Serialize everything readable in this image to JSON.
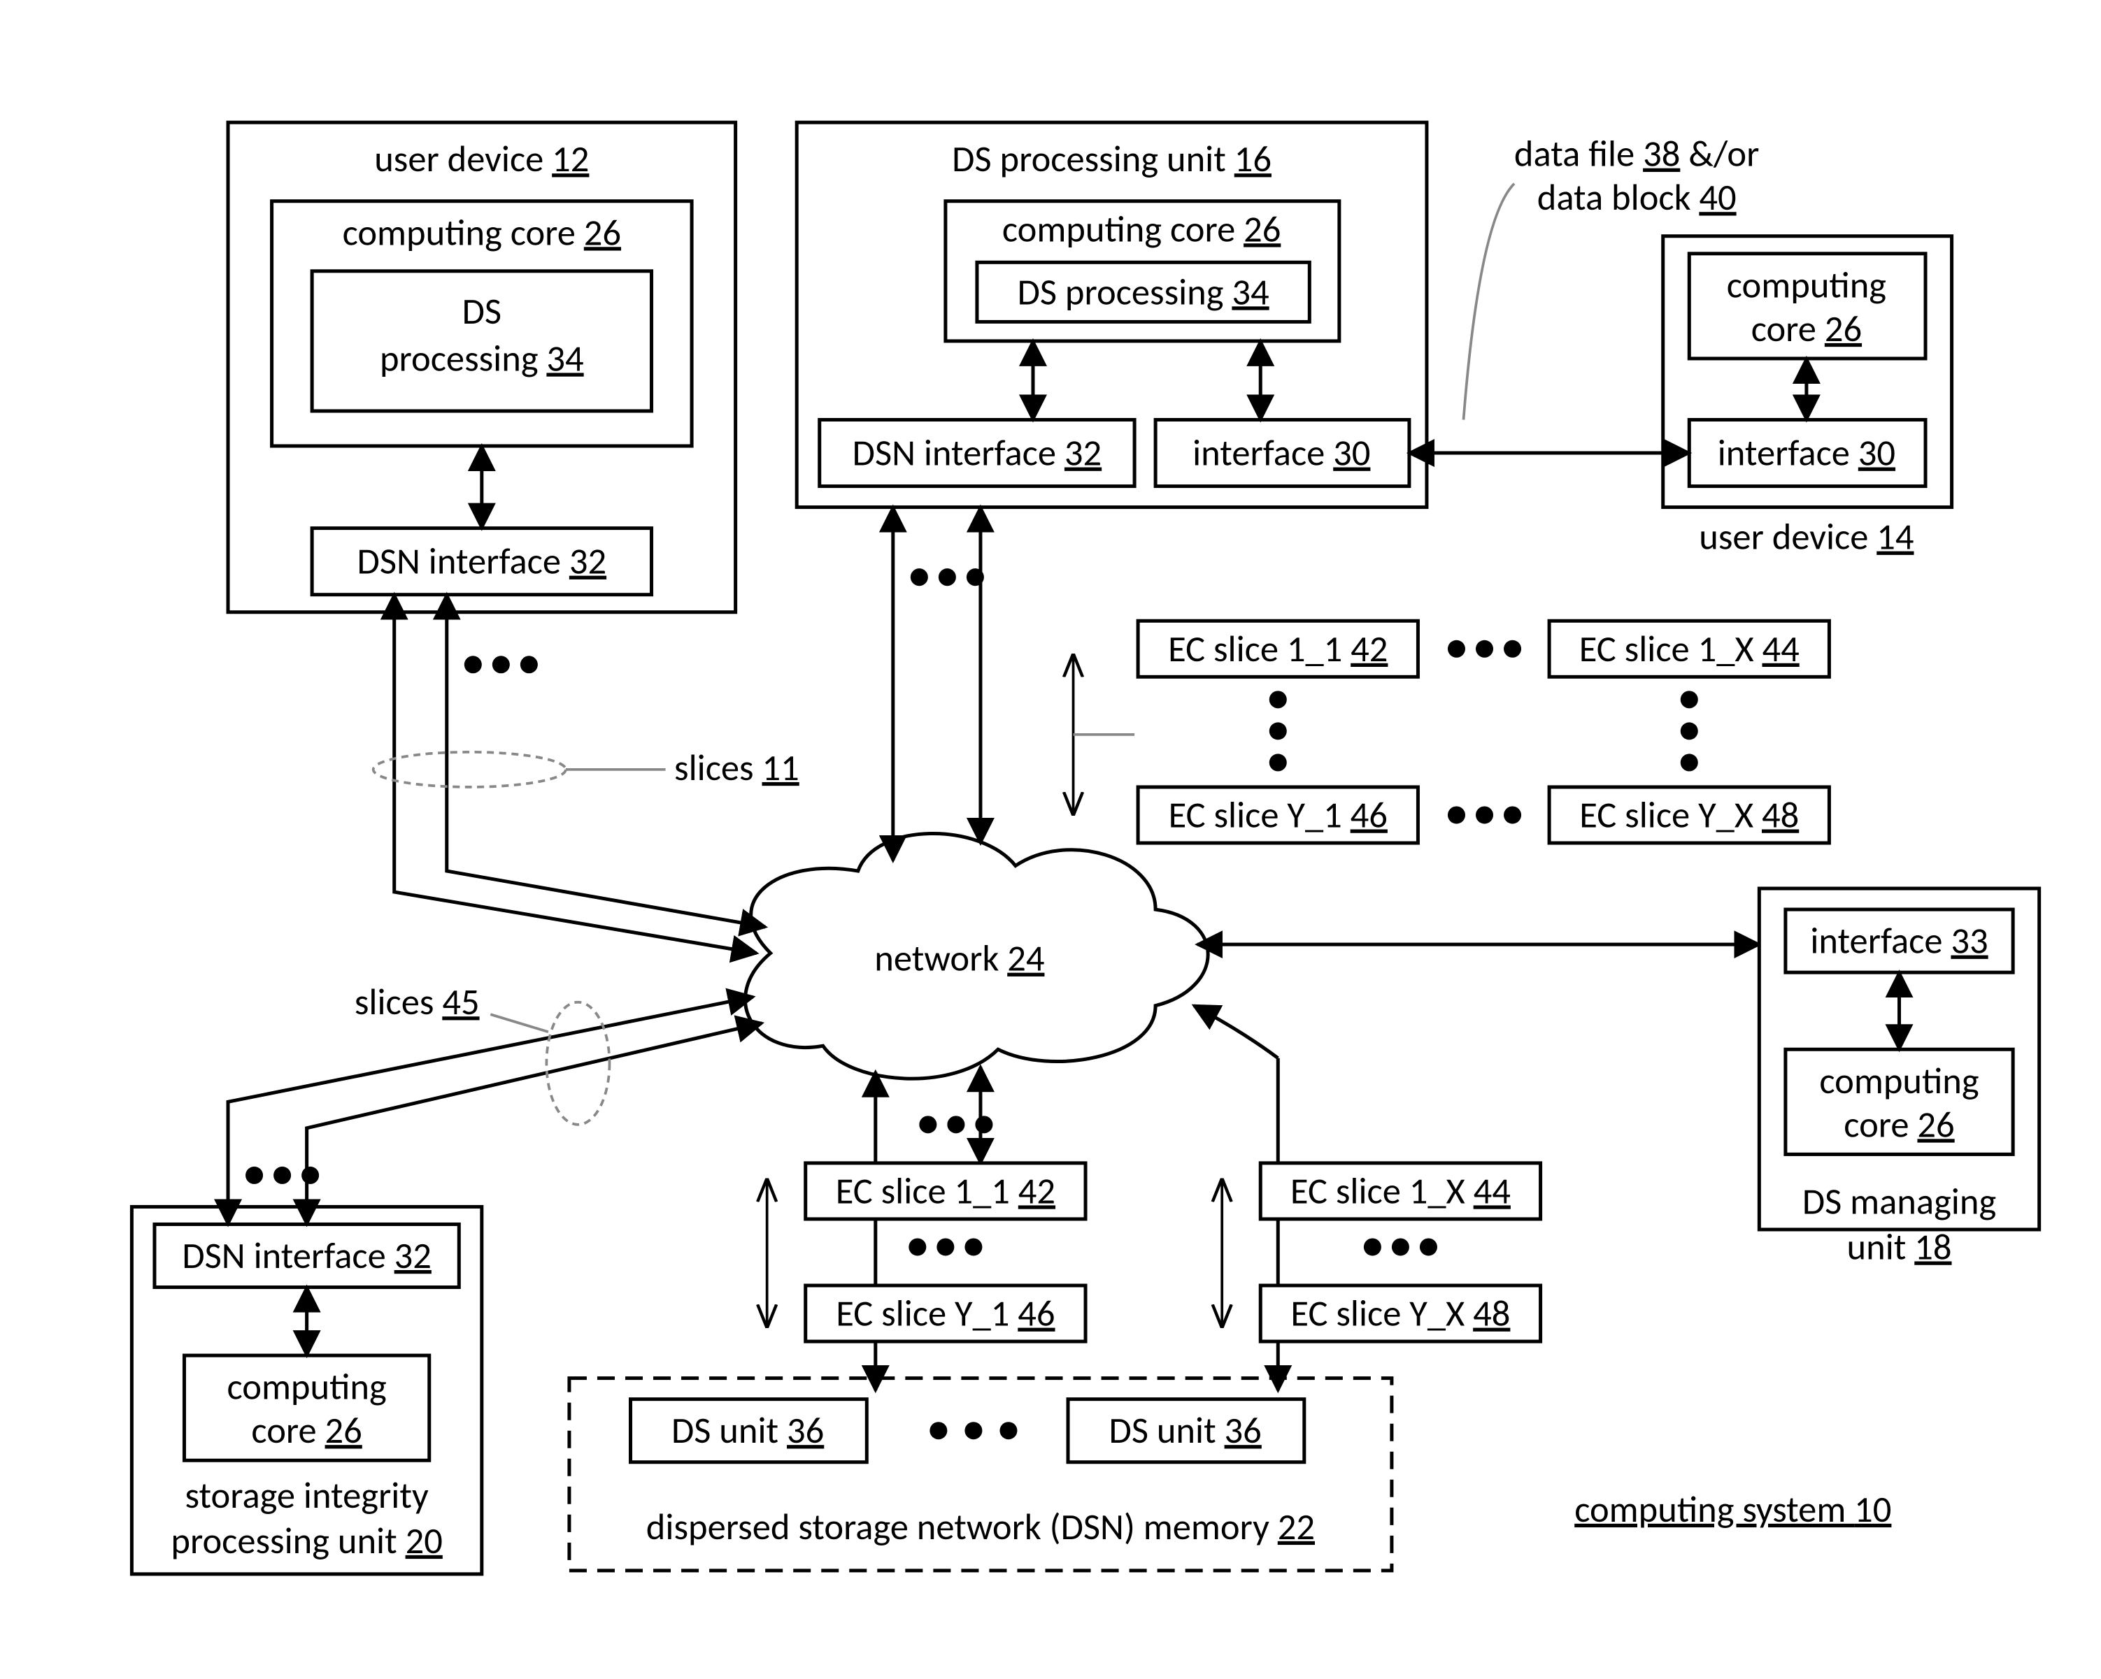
{
  "system_label": {
    "text": "computing system ",
    "num": "10"
  },
  "user_device_12": {
    "title": "user device ",
    "num": "12"
  },
  "computing_core_26_a": {
    "title": "computing core ",
    "num": "26"
  },
  "ds_processing_34_a": {
    "line1": "DS",
    "line2": "processing ",
    "num": "34"
  },
  "dsn_interface_32_a": {
    "title": "DSN interface ",
    "num": "32"
  },
  "ds_processing_unit_16": {
    "title": "DS processing unit ",
    "num": "16"
  },
  "computing_core_26_b": {
    "title": "computing core ",
    "num": "26"
  },
  "ds_processing_34_b": {
    "title": "DS processing ",
    "num": "34"
  },
  "dsn_interface_32_b": {
    "title": "DSN interface ",
    "num": "32"
  },
  "interface_30_b": {
    "title": "interface ",
    "num": "30"
  },
  "user_device_14": {
    "title": "user device ",
    "num": "14"
  },
  "computing_core_26_c": {
    "line1": "computing",
    "line2": "core ",
    "num": "26"
  },
  "interface_30_c": {
    "title": "interface ",
    "num": "30"
  },
  "data_file": {
    "line1a": "data file ",
    "num1": "38",
    "line1b": " &/or",
    "line2a": "data block ",
    "num2": "40"
  },
  "ec_top": {
    "a": {
      "t": "EC slice 1_1 ",
      "n": "42"
    },
    "b": {
      "t": "EC slice 1_X ",
      "n": "44"
    },
    "c": {
      "t": "EC slice Y_1 ",
      "n": "46"
    },
    "d": {
      "t": "EC slice Y_X ",
      "n": "48"
    }
  },
  "network": {
    "title": "network ",
    "num": "24"
  },
  "ds_managing_unit": {
    "title_l1": "DS managing",
    "title_l2": "unit ",
    "num": "18"
  },
  "interface_33": {
    "title": "interface ",
    "num": "33"
  },
  "computing_core_26_m": {
    "line1": "computing",
    "line2": "core ",
    "num": "26"
  },
  "slices11": {
    "t": "slices ",
    "n": "11"
  },
  "slices45": {
    "t": "slices ",
    "n": "45"
  },
  "ec_bot": {
    "a": {
      "t": "EC slice 1_1 ",
      "n": "42"
    },
    "b": {
      "t": "EC slice 1_X ",
      "n": "44"
    },
    "c": {
      "t": "EC slice Y_1 ",
      "n": "46"
    },
    "d": {
      "t": "EC slice Y_X ",
      "n": "48"
    }
  },
  "ds_unit": {
    "t": "DS unit ",
    "n": "36"
  },
  "dsn_memory": {
    "t": "dispersed storage network (DSN) memory ",
    "n": "22"
  },
  "storage_integrity": {
    "l1": "storage integrity",
    "l2": "processing unit ",
    "n": "20"
  },
  "dsn_interface_32_s": {
    "title": "DSN interface ",
    "num": "32"
  },
  "computing_core_26_s": {
    "line1": "computing",
    "line2": "core ",
    "num": "26"
  }
}
